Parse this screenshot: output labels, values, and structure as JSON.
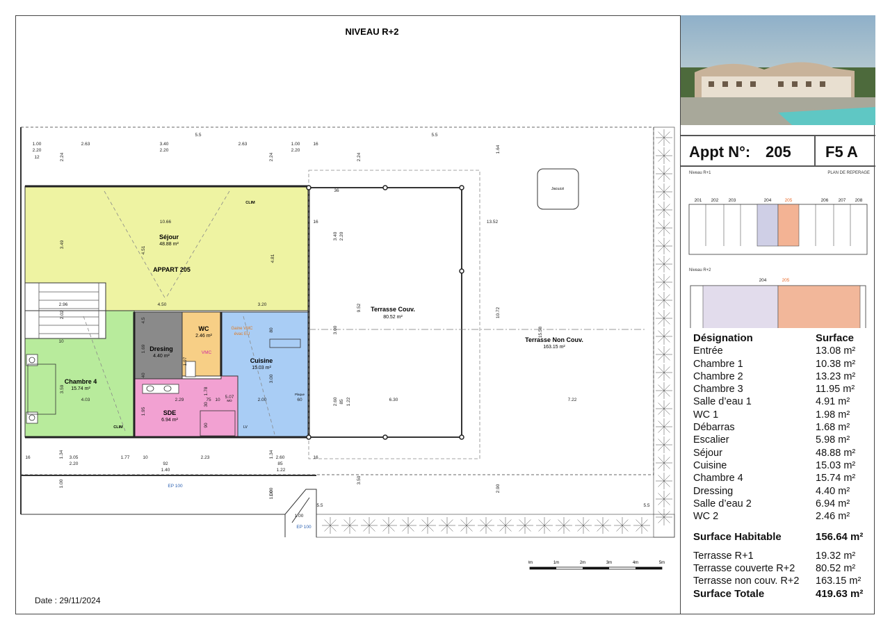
{
  "plan": {
    "level_title": "NIVEAU R+2",
    "date": "Date : 29/11/2024",
    "apartment_label": "APPART 205",
    "rooms": [
      {
        "id": "sejour",
        "name": "Séjour",
        "area": "48.88 m²",
        "color": "#eef3a2"
      },
      {
        "id": "chambre4",
        "name": "Chambre 4",
        "area": "15.74 m²",
        "color": "#b8eb9c"
      },
      {
        "id": "dressing",
        "name": "Dresing",
        "area": "4.40 m²",
        "color": "#8a8a8a"
      },
      {
        "id": "wc",
        "name": "WC",
        "area": "2.46 m²",
        "color": "#f7cf86"
      },
      {
        "id": "cuisine",
        "name": "Cuisine",
        "area": "15.03 m²",
        "color": "#a9cdf5"
      },
      {
        "id": "sde",
        "name": "SDE",
        "area": "6.94 m²",
        "color": "#f2a1d2"
      },
      {
        "id": "terrasse_couv",
        "name": "Terrasse Couv.",
        "area": "80.52 m²",
        "color": "#ffffff"
      },
      {
        "id": "terrasse_non_couv",
        "name": "Terrasse Non Couv.",
        "area": "163.15 m²",
        "color": "#ffffff"
      }
    ],
    "labels": {
      "clim": "CLIM",
      "jacuzzi": "Jacuzzi",
      "gaine": "Gaine VMC",
      "evac": "évac EU",
      "vmc": "VMC",
      "eu": "EU",
      "lv": "LV",
      "plaque": "Plaque",
      "mo": "MO",
      "ep": "EP 100"
    },
    "dims": {
      "top": [
        "1.00",
        "2.20",
        "2.63",
        "3.40",
        "2.20",
        "2.63",
        "1.00",
        "2.20",
        "5.5",
        "5.5",
        "1.64",
        "12",
        "2.24",
        "2.24",
        "16",
        "2.24"
      ],
      "inner": [
        "10.66",
        "4.50",
        "3.20",
        "3.49",
        "4.51",
        "4.81",
        "2.96",
        "2.02",
        "3.59",
        "4.03",
        "1.69",
        "1.95",
        "2.29",
        "1.78",
        "75",
        "10",
        "2.00",
        "60",
        "3.00",
        "80",
        "40",
        "36",
        "16",
        "3.40",
        "2.20",
        "13.52",
        "9.52",
        "10.72",
        "15.58",
        "6.30",
        "7.22",
        "3.00",
        "2.60",
        "85",
        "1.22",
        "10",
        "1.97",
        "30",
        "90",
        "5.07",
        "4.5"
      ],
      "bottom": [
        "16",
        "3.05",
        "1.77",
        "10",
        "92",
        "2.23",
        "2.60",
        "85",
        "1.34",
        "2.20",
        "1.40",
        "1.22",
        "1.34",
        "1.00",
        "3.50",
        "2.90",
        "1.00",
        "16",
        "1.00",
        "1.00",
        "5.5",
        "5.5"
      ]
    }
  },
  "scale": {
    "labels": [
      "0m",
      "1m",
      "2m",
      "3m",
      "4m",
      "5m"
    ]
  },
  "sidebar": {
    "appt_label": "Appt N°:",
    "appt_number": "205",
    "appt_type": "F5 A",
    "mini_plan": {
      "level1_label": "Niveau R+1",
      "plan_reperage": "PLAN DE REPERAGE",
      "units_r1": [
        "201",
        "202",
        "203",
        "204",
        "205",
        "206",
        "207",
        "208"
      ],
      "level2_label": "Niveau R+2",
      "units_r2": [
        "204",
        "205"
      ],
      "highlight_color": "#e86a2a"
    },
    "table": {
      "header_name": "Désignation",
      "header_value": "Surface",
      "rows": [
        {
          "name": "Entrée",
          "value": "13.08 m²"
        },
        {
          "name": "Chambre 1",
          "value": "10.38 m²"
        },
        {
          "name": "Chambre 2",
          "value": "13.23 m²"
        },
        {
          "name": "Chambre 3",
          "value": "11.95 m²"
        },
        {
          "name": "Salle d’eau 1",
          "value": "4.91 m²"
        },
        {
          "name": "WC 1",
          "value": "1.98 m²"
        },
        {
          "name": "Débarras",
          "value": "1.68 m²"
        },
        {
          "name": "Escalier",
          "value": "5.98 m²"
        },
        {
          "name": "Séjour",
          "value": "48.88 m²"
        },
        {
          "name": "Cuisine",
          "value": "15.03 m²"
        },
        {
          "name": "Chambre 4",
          "value": "15.74 m²"
        },
        {
          "name": "Dressing",
          "value": "4.40 m²"
        },
        {
          "name": "Salle d’eau 2",
          "value": "6.94 m²"
        },
        {
          "name": "WC 2",
          "value": "2.46 m²"
        }
      ],
      "habitable_label": "Surface Habitable",
      "habitable_value": "156.64 m²",
      "extra_rows": [
        {
          "name": "Terrasse R+1",
          "value": "19.32 m²"
        },
        {
          "name": "Terrasse couverte R+2",
          "value": "80.52 m²"
        },
        {
          "name": "Terrasse non couv. R+2",
          "value": "163.15 m²"
        }
      ],
      "total_label": "Surface Totale",
      "total_value": "419.63 m²"
    }
  }
}
